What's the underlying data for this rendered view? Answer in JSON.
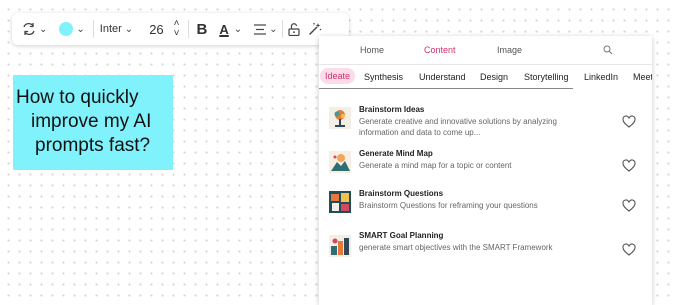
{
  "toolbar": {
    "font_family": "Inter",
    "font_size": "26",
    "bold_label": "B",
    "text_color_label": "A",
    "fill_color": "#7ff2fb"
  },
  "sticky_note": {
    "lines": [
      "How to quickly",
      "improve my AI",
      "prompts fast?"
    ],
    "color": "#7ff2fb"
  },
  "panel": {
    "top_tabs": [
      "Home",
      "Content",
      "Image"
    ],
    "active_top_tab": "Content",
    "sub_tabs": [
      "Ideate",
      "Synthesis",
      "Understand",
      "Design",
      "Storytelling",
      "LinkedIn",
      "Meet"
    ],
    "active_sub_tab": "Ideate",
    "accent_color": "#d1306e",
    "items": [
      {
        "title": "Brainstorm Ideas",
        "description": "Generate creative and innovative solutions by analyzing information and data to come up...",
        "icon": "brainstorm-ideas-thumbnail"
      },
      {
        "title": "Generate Mind Map",
        "description": "Generate a mind map for a topic or content",
        "icon": "mind-map-thumbnail"
      },
      {
        "title": "Brainstorm Questions",
        "description": "Brainstorm Questions for reframing your questions",
        "icon": "brainstorm-questions-thumbnail"
      },
      {
        "title": "SMART Goal Planning",
        "description": "generate smart objectives with the SMART Framework",
        "icon": "smart-goal-thumbnail"
      }
    ]
  }
}
